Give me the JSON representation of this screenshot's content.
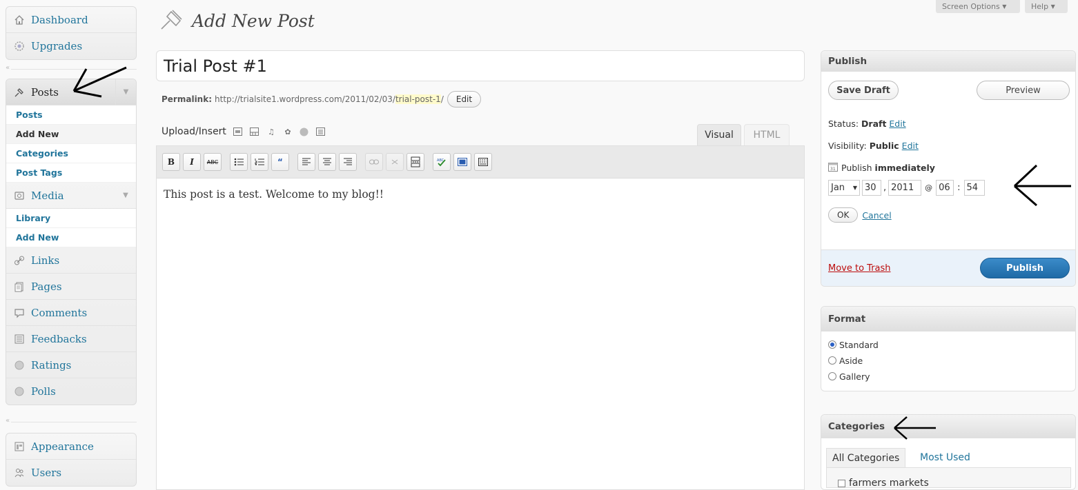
{
  "header": {
    "page_title": "Add New Post",
    "screen_options": "Screen Options",
    "help": "Help"
  },
  "sidebar": {
    "top": [
      {
        "label": "Dashboard",
        "icon": "dashboard-icon"
      },
      {
        "label": "Upgrades",
        "icon": "upgrades-icon"
      }
    ],
    "posts": {
      "label": "Posts",
      "sub": [
        "Posts",
        "Add New",
        "Categories",
        "Post Tags"
      ],
      "current": "Add New"
    },
    "media": {
      "label": "Media",
      "sub": [
        "Library",
        "Add New"
      ]
    },
    "items": [
      {
        "label": "Links",
        "icon": "links-icon"
      },
      {
        "label": "Pages",
        "icon": "pages-icon"
      },
      {
        "label": "Comments",
        "icon": "comments-icon"
      },
      {
        "label": "Feedbacks",
        "icon": "feedbacks-icon"
      },
      {
        "label": "Ratings",
        "icon": "ratings-icon"
      },
      {
        "label": "Polls",
        "icon": "polls-icon"
      }
    ],
    "bottom": [
      {
        "label": "Appearance",
        "icon": "appearance-icon"
      },
      {
        "label": "Users",
        "icon": "users-icon"
      }
    ],
    "collapse_glyph": "«"
  },
  "post": {
    "title": "Trial Post #1",
    "permalink_label": "Permalink:",
    "permalink_base": "http://trialsite1.wordpress.com/2011/02/03/",
    "permalink_slug": "trial-post-1",
    "permalink_end": "/",
    "edit_label": "Edit",
    "body": "This post is a test. Welcome to my blog!!"
  },
  "editor": {
    "upload_label": "Upload/Insert",
    "tab_visual": "Visual",
    "tab_html": "HTML"
  },
  "publish": {
    "title": "Publish",
    "save_draft": "Save Draft",
    "preview": "Preview",
    "status_label": "Status:",
    "status_value": "Draft",
    "visibility_label": "Visibility:",
    "visibility_value": "Public",
    "edit_link": "Edit",
    "schedule_prefix": "Publish",
    "schedule_value": "immediately",
    "month": "Jan",
    "day": "30",
    "year": "2011",
    "hour": "06",
    "minute": "54",
    "comma": ",",
    "at": "@",
    "colon": ":",
    "ok": "OK",
    "cancel": "Cancel",
    "trash": "Move to Trash",
    "publish_btn": "Publish"
  },
  "format": {
    "title": "Format",
    "options": [
      "Standard",
      "Aside",
      "Gallery"
    ],
    "selected": "Standard"
  },
  "categories": {
    "title": "Categories",
    "tab_all": "All Categories",
    "tab_most": "Most Used",
    "first_item": "farmers markets"
  },
  "colors": {
    "link": "#21759b",
    "publish_button": "#2e7ab8",
    "trash": "#bc0b0b",
    "annotation_arrow": "#000000"
  }
}
